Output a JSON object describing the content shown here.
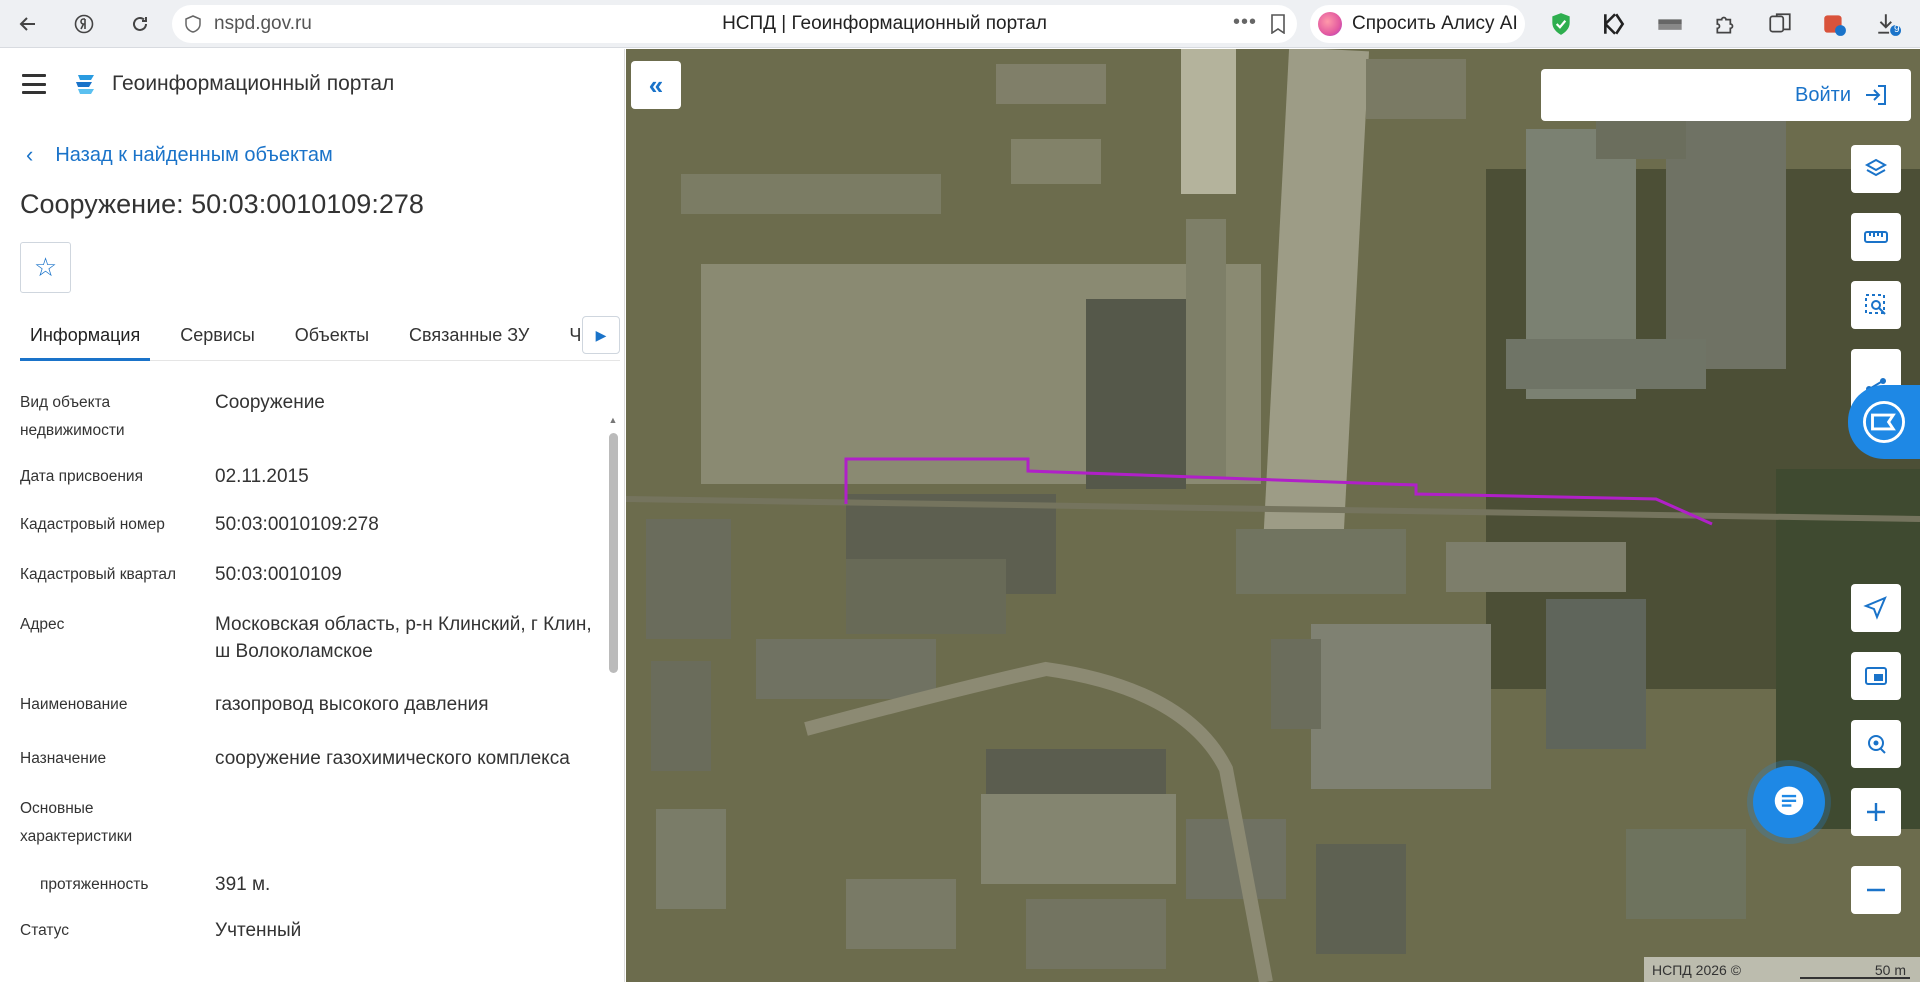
{
  "browser": {
    "url": "nspd.gov.ru",
    "tab_title": "НСПД | Геоинформационный портал",
    "alice_label": "Спросить Алису AI",
    "download_count": "9"
  },
  "app": {
    "title": "Геоинформационный портал",
    "back_label": "Назад к найденным объектам",
    "object_title": "Сооружение: 50:03:0010109:278"
  },
  "tabs": [
    {
      "label": "Информация",
      "active": true
    },
    {
      "label": "Сервисы"
    },
    {
      "label": "Объекты"
    },
    {
      "label": "Связанные ЗУ"
    },
    {
      "label": "Ча"
    }
  ],
  "props": [
    {
      "key": "Вид объекта недвижимости",
      "value": "Сооружение"
    },
    {
      "key": "Дата присвоения",
      "value": "02.11.2015"
    },
    {
      "key": "Кадастровый номер",
      "value": "50:03:0010109:278"
    },
    {
      "key": "Кадастровый квартал",
      "value": "50:03:0010109"
    },
    {
      "key": "Адрес",
      "value": "Московская область, р-н Клинский, г Клин, ш Волоколамское"
    },
    {
      "key": "Наименование",
      "value": "газопровод высокого давления"
    },
    {
      "key": "Назначение",
      "value": "сооружение газохимического комплекса"
    },
    {
      "key": "Основные характеристики",
      "value": ""
    },
    {
      "key": "протяженность",
      "value": "391 м."
    },
    {
      "key": "Статус",
      "value": "Учтенный"
    }
  ],
  "map": {
    "login_label": "Войти",
    "attribution": "НСПД 2026 ©",
    "scale_label": "50 m",
    "line_color": "#b020c8"
  }
}
